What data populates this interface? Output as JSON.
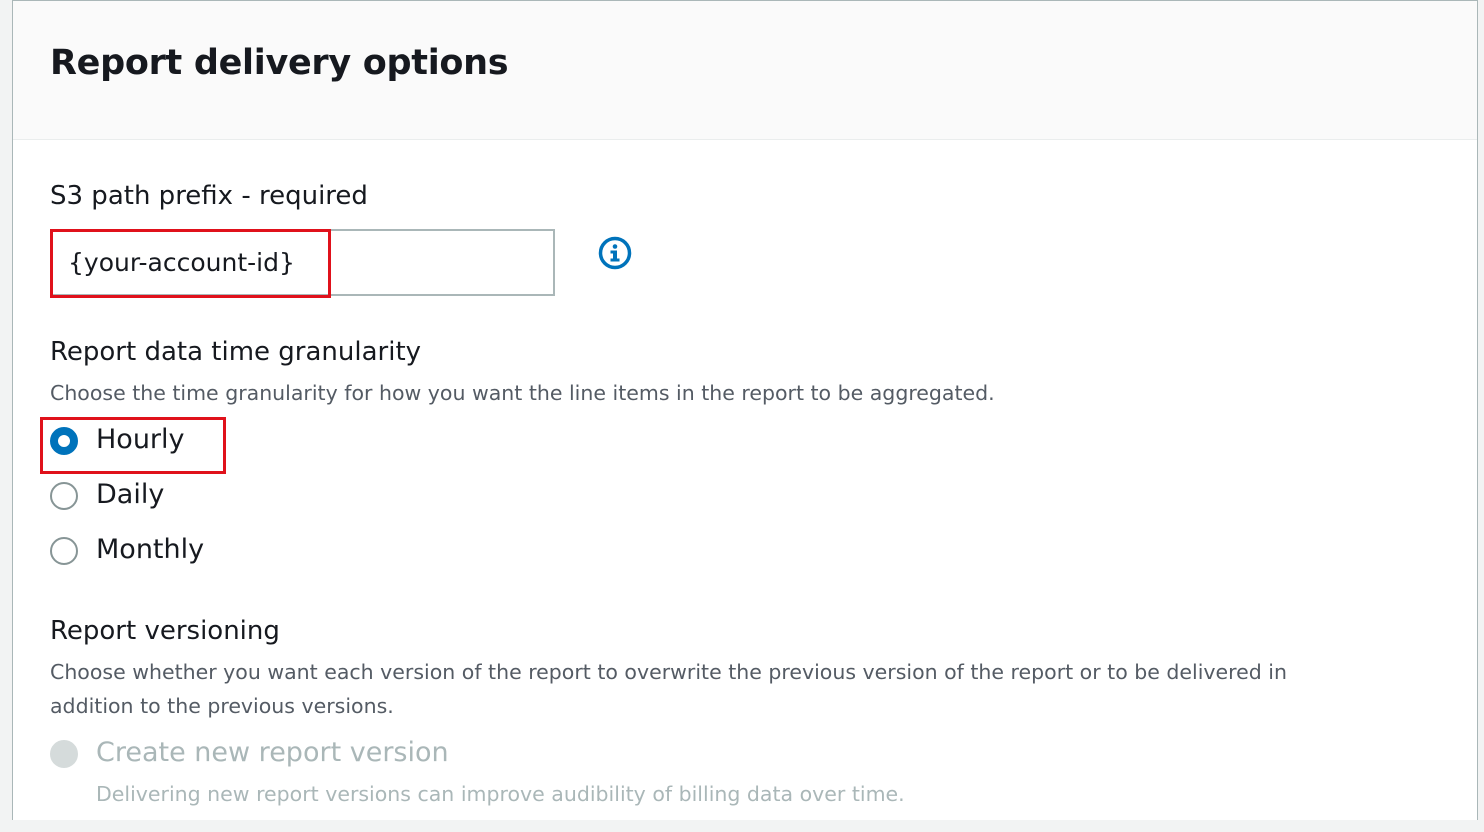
{
  "section": {
    "title": "Report delivery options"
  },
  "s3_prefix": {
    "label": "S3 path prefix - required",
    "value": "{your-account-id}"
  },
  "granularity": {
    "label": "Report data time granularity",
    "description": "Choose the time granularity for how you want the line items in the report to be aggregated.",
    "options": [
      {
        "label": "Hourly",
        "selected": true
      },
      {
        "label": "Daily",
        "selected": false
      },
      {
        "label": "Monthly",
        "selected": false
      }
    ]
  },
  "versioning": {
    "label": "Report versioning",
    "description_line1": "Choose whether you want each version of the report to overwrite the previous version of the report or to be delivered in",
    "description_line2": "addition to the previous versions.",
    "options": [
      {
        "label": "Create new report version",
        "description": "Delivering new report versions can improve audibility of billing data over time.",
        "selected": false,
        "disabled": true
      }
    ]
  },
  "colors": {
    "accent": "#0073bb",
    "highlight": "#e0111b",
    "text": "#16191f",
    "muted": "#545b64",
    "disabled": "#aab7b8"
  },
  "icons": {
    "info": "info-icon"
  }
}
